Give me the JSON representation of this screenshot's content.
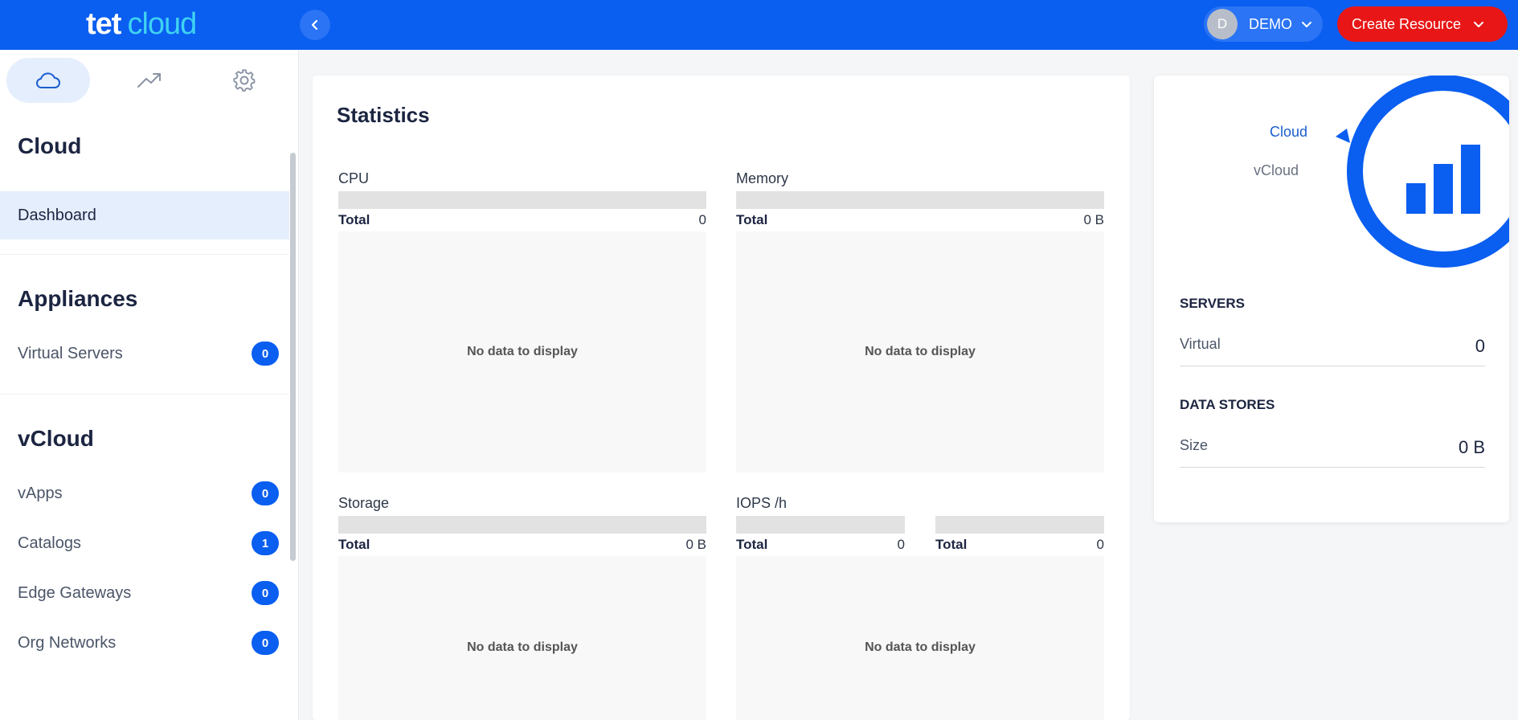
{
  "topbar": {
    "logo_primary": "tet",
    "logo_secondary": "cloud",
    "user_initial": "D",
    "user_name": "DEMO",
    "create_label": "Create Resource"
  },
  "sidebar": {
    "tabs": [
      {
        "icon": "cloud-icon"
      },
      {
        "icon": "trending-up-icon"
      },
      {
        "icon": "gear-icon"
      }
    ],
    "sections": {
      "cloud": {
        "title": "Cloud",
        "items": [
          {
            "label": "Dashboard"
          }
        ]
      },
      "appliances": {
        "title": "Appliances",
        "items": [
          {
            "label": "Virtual Servers",
            "count": "0"
          }
        ]
      },
      "vcloud": {
        "title": "vCloud",
        "items": [
          {
            "label": "vApps",
            "count": "0"
          },
          {
            "label": "Catalogs",
            "count": "1"
          },
          {
            "label": "Edge Gateways",
            "count": "0"
          },
          {
            "label": "Org Networks",
            "count": "0"
          }
        ]
      }
    }
  },
  "statistics": {
    "title": "Statistics",
    "no_data": "No data to display",
    "total_label": "Total",
    "cpu": {
      "label": "CPU",
      "total": "0"
    },
    "memory": {
      "label": "Memory",
      "total": "0 B"
    },
    "storage": {
      "label": "Storage",
      "total": "0 B"
    },
    "iops": {
      "label": "IOPS /h",
      "total_left": "0",
      "total_right": "0"
    }
  },
  "info_card": {
    "legend_cloud": "Cloud",
    "legend_vcloud": "vCloud",
    "servers_title": "SERVERS",
    "virtual_label": "Virtual",
    "virtual_value": "0",
    "datastores_title": "DATA STORES",
    "size_label": "Size",
    "size_value": "0 B"
  },
  "colors": {
    "brand_blue": "#0a5ef0",
    "accent_red": "#e81616",
    "logo_cyan": "#3fd2f2"
  }
}
